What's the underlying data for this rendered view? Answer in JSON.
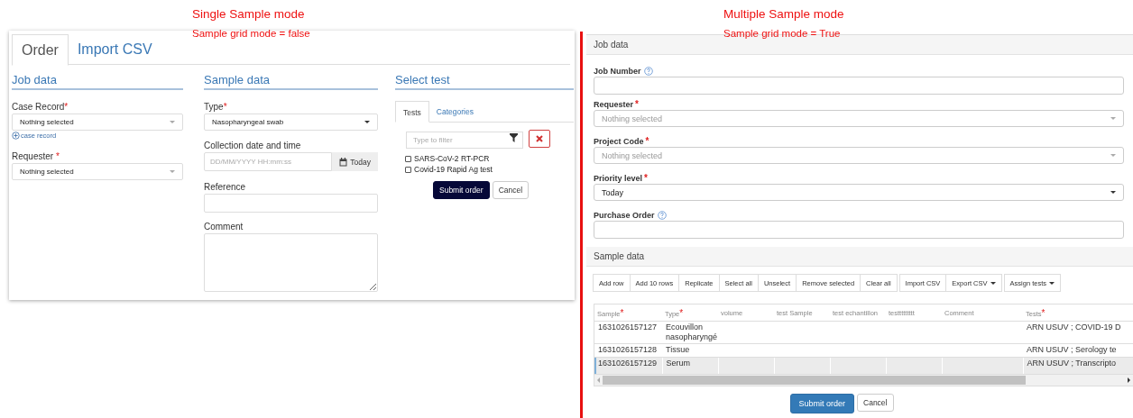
{
  "annotations": [
    {
      "title": "Single Sample mode",
      "subtitle": "Sample grid mode = false"
    },
    {
      "title": "Multiple Sample mode",
      "subtitle": "Sample grid mode = True"
    }
  ],
  "single_sample": {
    "tabs": [
      {
        "label": "Order",
        "selected": true
      },
      {
        "label": "Import CSV",
        "selected": false
      }
    ],
    "job_data": {
      "heading": "Job data",
      "fields": [
        {
          "kind": "select",
          "label": "Case Record",
          "required_mark": "*",
          "value": "Nothing selected",
          "link": "case record"
        },
        {
          "kind": "select",
          "label": "Requester ",
          "required_mark": "*",
          "value": "Nothing selected"
        }
      ]
    },
    "sample_data": {
      "heading": "Sample data",
      "fields": [
        {
          "kind": "select",
          "label": "Type",
          "required_mark": "*",
          "value": "Nasopharyngeal swab",
          "dark_caret": true
        },
        {
          "kind": "datetime",
          "label": "Collection date and time",
          "placeholder": "DD/MM/YYYY HH:mm:ss",
          "addon": "Today"
        },
        {
          "kind": "text",
          "label": "Reference"
        },
        {
          "kind": "textarea",
          "label": "Comment"
        }
      ]
    },
    "select_test": {
      "heading": "Select test",
      "tabs": [
        {
          "label": "Tests",
          "selected": true
        },
        {
          "label": "Categories",
          "selected": false
        }
      ],
      "filter": {
        "placeholder": "Type to filter"
      },
      "tests": [
        {
          "label": "SARS-CoV-2 RT-PCR",
          "checked": false
        },
        {
          "label": "Covid-19 Rapid Ag test",
          "checked": false
        }
      ],
      "buttons": [
        {
          "label": "Submit order",
          "kind": "primary"
        },
        {
          "label": "Cancel",
          "kind": "default"
        }
      ]
    }
  },
  "multiple_sample": {
    "job_data": {
      "heading": "Job data",
      "fields": [
        {
          "kind": "text",
          "label": "Job Number",
          "help": true
        },
        {
          "kind": "select",
          "label": "Requester",
          "required_mark": "*",
          "placeholder": "Nothing selected"
        },
        {
          "kind": "select",
          "label": "Project Code",
          "required_mark": "*",
          "placeholder": "Nothing selected"
        },
        {
          "kind": "select",
          "label": "Priority level",
          "required_mark": "*",
          "value": "Today",
          "dark_caret": true
        },
        {
          "kind": "text",
          "label": "Purchase Order",
          "help": true
        }
      ]
    },
    "sample_data": {
      "heading": "Sample data",
      "toolbar": [
        {
          "group": [
            {
              "label": "Add row",
              "dropdown": false
            },
            {
              "label": "Add 10 rows",
              "dropdown": false
            },
            {
              "label": "Replicate",
              "dropdown": false
            },
            {
              "label": "Select all",
              "dropdown": false
            },
            {
              "label": "Unselect",
              "dropdown": false
            },
            {
              "label": "Remove selected",
              "dropdown": false
            },
            {
              "label": "Clear all",
              "dropdown": false
            }
          ]
        },
        {
          "group": [
            {
              "label": "Import CSV",
              "dropdown": false
            },
            {
              "label": "Export CSV",
              "dropdown": true
            }
          ]
        },
        {
          "group": [
            {
              "label": "Assign tests",
              "dropdown": true
            }
          ]
        }
      ],
      "table": {
        "columns": [
          {
            "label": "Sample",
            "required_mark": "*"
          },
          {
            "label": "Type",
            "required_mark": "*"
          },
          {
            "label": "volume"
          },
          {
            "label": "test Sample"
          },
          {
            "label": "test echantillon"
          },
          {
            "label": "testtttttttt"
          },
          {
            "label": "Comment"
          },
          {
            "label": "Tests",
            "required_mark": "*"
          }
        ],
        "rows": [
          {
            "selected": false,
            "cells": [
              "1631026157127",
              "Ecouvillon nasopharyngé",
              "",
              "",
              "",
              "",
              "",
              "ARN USUV ;  COVID-19 D"
            ]
          },
          {
            "selected": false,
            "cells": [
              "1631026157128",
              "Tissue",
              "",
              "",
              "",
              "",
              "",
              "ARN USUV ;  Serology te"
            ]
          },
          {
            "selected": true,
            "cells": [
              "1631026157129",
              "Serum",
              "",
              "",
              "",
              "",
              "",
              "ARN USUV ;  Transcripto"
            ]
          }
        ]
      }
    },
    "buttons": [
      {
        "label": "Submit order",
        "kind": "primary"
      },
      {
        "label": "Cancel",
        "kind": "default"
      }
    ]
  }
}
